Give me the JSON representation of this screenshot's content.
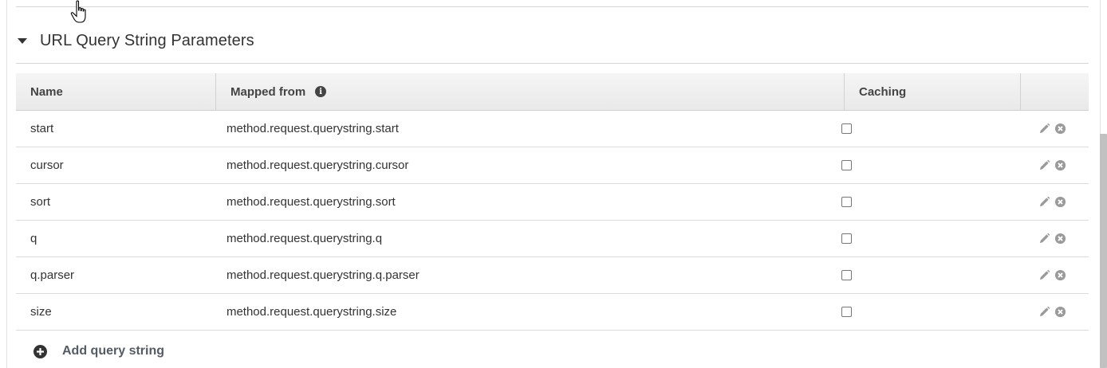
{
  "section": {
    "title": "URL Query String Parameters"
  },
  "table": {
    "columns": {
      "name": "Name",
      "mapped_from": "Mapped from",
      "caching": "Caching"
    },
    "rows": [
      {
        "name": "start",
        "mapped_from": "method.request.querystring.start",
        "caching": false
      },
      {
        "name": "cursor",
        "mapped_from": "method.request.querystring.cursor",
        "caching": false
      },
      {
        "name": "sort",
        "mapped_from": "method.request.querystring.sort",
        "caching": false
      },
      {
        "name": "q",
        "mapped_from": "method.request.querystring.q",
        "caching": false
      },
      {
        "name": "q.parser",
        "mapped_from": "method.request.querystring.q.parser",
        "caching": false
      },
      {
        "name": "size",
        "mapped_from": "method.request.querystring.size",
        "caching": false
      }
    ]
  },
  "add_button": {
    "label": "Add query string",
    "icon": "plus-circle-icon"
  },
  "icons": {
    "info": "info-icon",
    "edit": "pencil-icon",
    "delete": "close-circle-icon",
    "section_toggle": "caret-down-icon",
    "cursor": "hand-pointer-icon"
  },
  "colors": {
    "header_bg": "#eeeeee",
    "text": "#333333",
    "add_label": "#545b64",
    "action_icon": "#9a9a9a"
  }
}
